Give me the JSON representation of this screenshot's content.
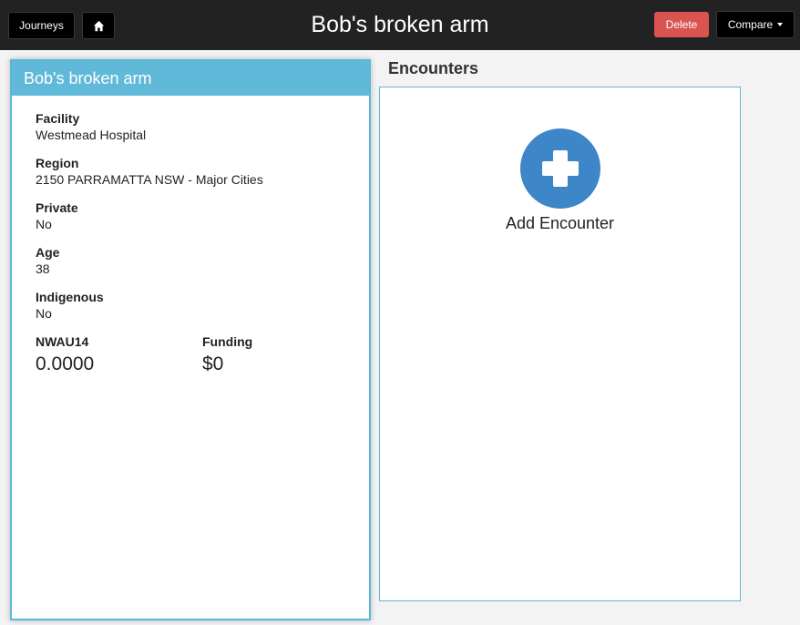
{
  "topbar": {
    "journeys_label": "Journeys",
    "home_icon": "home-icon",
    "title": "Bob's broken arm",
    "delete_label": "Delete",
    "compare_label": "Compare"
  },
  "journey": {
    "title": "Bob's broken arm",
    "fields": [
      {
        "label": "Facility",
        "value": "Westmead Hospital"
      },
      {
        "label": "Region",
        "value": "2150 PARRAMATTA NSW - Major Cities"
      },
      {
        "label": "Private",
        "value": "No"
      },
      {
        "label": "Age",
        "value": "38"
      },
      {
        "label": "Indigenous",
        "value": "No"
      }
    ],
    "metrics": [
      {
        "label": "NWAU14",
        "value": "0.0000"
      },
      {
        "label": "Funding",
        "value": "$0"
      }
    ]
  },
  "encounters": {
    "title": "Encounters",
    "add_label": "Add Encounter",
    "add_icon": "plus-icon"
  },
  "colors": {
    "topbar": "#222222",
    "accent": "#60b9d8",
    "delete": "#d9534f",
    "add_button": "#3d86c8"
  }
}
